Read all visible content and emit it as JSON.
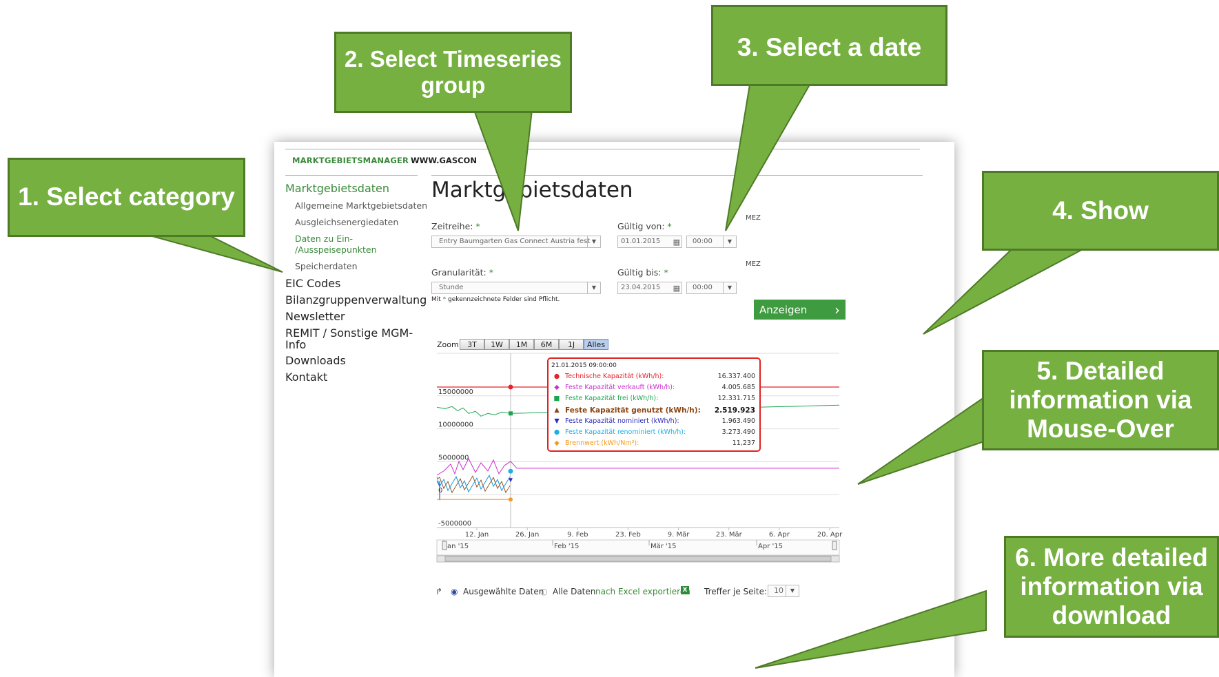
{
  "header": {
    "brand": "MARKTGEBIETSMANAGER",
    "site": "WWW.GASCON"
  },
  "sidebar": {
    "section_title": "Marktgebietsdaten",
    "sub_items": [
      {
        "label": "Allgemeine Marktgebietsdaten"
      },
      {
        "label": "Ausgleichsenergiedaten"
      },
      {
        "label": "Daten zu Ein-",
        "label2": "/Ausspeisepunkten"
      },
      {
        "label": "Speicherdaten"
      }
    ],
    "main_items": [
      {
        "label": "EIC Codes"
      },
      {
        "label": "Bilanzgruppenverwaltung"
      },
      {
        "label": "Newsletter"
      },
      {
        "label": "REMIT / Sonstige MGM-",
        "label2": "Info"
      },
      {
        "label": "Downloads"
      },
      {
        "label": "Kontakt"
      }
    ]
  },
  "main": {
    "title": "Marktgebietsdaten",
    "zeitreihe": {
      "label": "Zeitreihe:",
      "req": "*",
      "value": "Entry Baumgarten Gas Connect Austria fest"
    },
    "granularitaet": {
      "label": "Granularität:",
      "req": "*",
      "value": "Stunde"
    },
    "gueltig_von": {
      "label": "Gültig von:",
      "req": "*",
      "date": "01.01.2015",
      "time": "00:00",
      "tz": "MEZ"
    },
    "gueltig_bis": {
      "label": "Gültig bis:",
      "req": "*",
      "date": "23.04.2015",
      "time": "00:00",
      "tz": "MEZ"
    },
    "required_note_a": "Mit",
    "required_note_star": "*",
    "required_note_b": "gekennzeichnete Felder sind Pflicht.",
    "show_button": "Anzeigen",
    "show_arrow": "›"
  },
  "chart_data": {
    "type": "line",
    "zoom_label": "Zoom",
    "zoom_buttons": [
      "3T",
      "1W",
      "1M",
      "6M",
      "1J",
      "Alles"
    ],
    "zoom_active": "Alles",
    "y_ticks": [
      "15000000",
      "10000000",
      "5000000",
      "0",
      "-5000000"
    ],
    "y_tick_values": [
      15000000,
      10000000,
      5000000,
      0,
      -5000000
    ],
    "ylim": [
      -5000000,
      20000000
    ],
    "x_ticks": [
      "12. Jan",
      "26. Jan",
      "9. Feb",
      "23. Feb",
      "9. Mär",
      "23. Mär",
      "6. Apr",
      "20. Apr"
    ],
    "navigator_labels": [
      "Jan '15",
      "Feb '15",
      "Mär '15",
      "Apr '15"
    ],
    "series": [
      {
        "name": "Technische Kapazität (kWh/h)",
        "color": "#e8212a",
        "level": 16337400
      },
      {
        "name": "Feste Kapazität frei (kWh/h)",
        "color": "#1aa650",
        "level": 12331715
      },
      {
        "name": "Feste Kapazität verkauft (kWh/h)",
        "color": "#cc2fcc",
        "level": 4005685
      },
      {
        "name": "Brennwert (kWh/Nm³)",
        "color": "#f59a1b",
        "level": 11
      }
    ],
    "tooltip": {
      "header": "21.01.2015 09:00:00",
      "rows": [
        {
          "symbol": "●",
          "name": "Technische Kapazität (kWh/h):",
          "value": "16.337.400",
          "color": "#e8212a",
          "bold": false
        },
        {
          "symbol": "◆",
          "name": "Feste Kapazität verkauft (kWh/h):",
          "value": "4.005.685",
          "color": "#cc2fcc",
          "bold": false
        },
        {
          "symbol": "■",
          "name": "Feste Kapazität frei (kWh/h):",
          "value": "12.331.715",
          "color": "#1aa650",
          "bold": false
        },
        {
          "symbol": "▲",
          "name": "Feste Kapazität genutzt (kWh/h):",
          "value": "2.519.923",
          "color": "#8b4513",
          "bold": true
        },
        {
          "symbol": "▼",
          "name": "Feste Kapazität nominiert (kWh/h):",
          "value": "1.963.490",
          "color": "#2b2bb8",
          "bold": false
        },
        {
          "symbol": "●",
          "name": "Feste Kapazität renominiert (kWh/h):",
          "value": "3.273.490",
          "color": "#1ab0e6",
          "bold": false
        },
        {
          "symbol": "◆",
          "name": "Brennwert (kWh/Nm³):",
          "value": "11,237",
          "color": "#f59a1b",
          "bold": false
        }
      ]
    }
  },
  "bottom": {
    "radio1": "Ausgewählte Daten",
    "radio2": "Alle Daten",
    "export": "nach Excel exportieren",
    "per_page_label": "Treffer je Seite:",
    "per_page_value": "10"
  },
  "callouts": {
    "c1": "1. Select category",
    "c2": "2. Select Timeseries group",
    "c3": "3. Select a date",
    "c4": "4. Show",
    "c5": "5. Detailed information via Mouse-Over",
    "c6": "6. More detailed information via download"
  },
  "colors": {
    "brand_green": "#3a8a3a",
    "callout_green": "#76b041",
    "callout_border": "#4e7a27"
  }
}
